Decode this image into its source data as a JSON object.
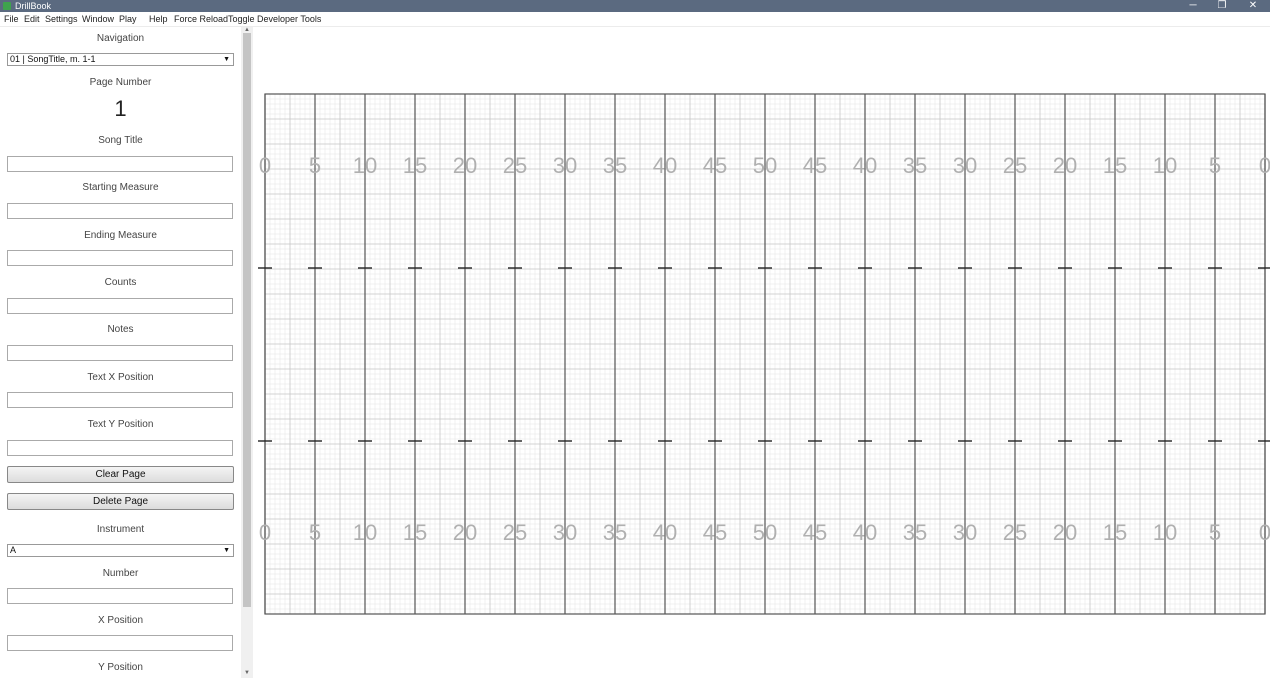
{
  "window": {
    "title": "DrillBook",
    "minimize": "─",
    "maximize": "❐",
    "close": "✕"
  },
  "menu": [
    "File",
    "Edit",
    "Settings",
    "Window",
    "Play",
    "Help",
    "Force Reload",
    "Toggle Developer Tools"
  ],
  "sidebar": {
    "navigation_label": "Navigation",
    "navigation_value": "01 | SongTitle, m. 1-1",
    "page_number_label": "Page Number",
    "page_number": "1",
    "song_title_label": "Song Title",
    "starting_measure_label": "Starting Measure",
    "ending_measure_label": "Ending Measure",
    "counts_label": "Counts",
    "notes_label": "Notes",
    "text_x_label": "Text X Position",
    "text_y_label": "Text Y Position",
    "clear_page": "Clear Page",
    "delete_page": "Delete Page",
    "instrument_label": "Instrument",
    "instrument_value": "A",
    "number_label": "Number",
    "x_position_label": "X Position",
    "y_position_label": "Y Position"
  },
  "field": {
    "yard_numbers": [
      "0",
      "5",
      "10",
      "15",
      "20",
      "25",
      "30",
      "35",
      "40",
      "45",
      "50",
      "45",
      "40",
      "35",
      "30",
      "25",
      "20",
      "15",
      "10",
      "5",
      "0"
    ],
    "line_color": "#555555",
    "grid_color": "#c8c8c8",
    "number_color": "#b0b0b0"
  }
}
